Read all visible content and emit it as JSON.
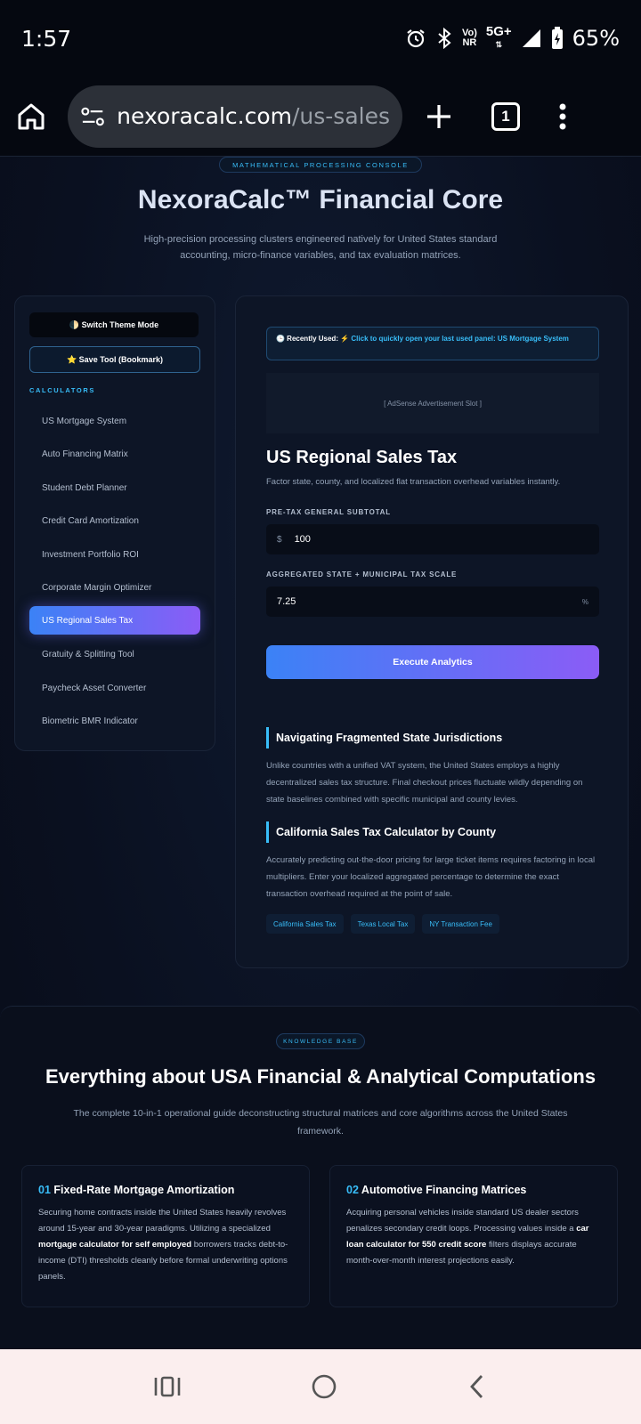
{
  "status": {
    "time": "1:57",
    "net_top": "Vo)",
    "net_bottom": "NR",
    "signal": "5G+",
    "battery": "65%"
  },
  "browser": {
    "url_host": "nexoracalc.com",
    "url_path": "/us-sales",
    "tab_count": "1"
  },
  "hero": {
    "badge": "MATHEMATICAL PROCESSING CONSOLE",
    "title": "NexoraCalc™ Financial Core",
    "subtitle": "High-precision processing clusters engineered natively for United States standard accounting, micro-finance variables, and tax evaluation matrices."
  },
  "sidebar": {
    "theme_button": "🌓 Switch Theme Mode",
    "save_button": "⭐ Save Tool (Bookmark)",
    "heading": "CALCULATORS",
    "items": [
      {
        "label": "US Mortgage System"
      },
      {
        "label": "Auto Financing Matrix"
      },
      {
        "label": "Student Debt Planner"
      },
      {
        "label": "Credit Card Amortization"
      },
      {
        "label": "Investment Portfolio ROI"
      },
      {
        "label": "Corporate Margin Optimizer"
      },
      {
        "label": "US Regional Sales Tax"
      },
      {
        "label": "Gratuity & Splitting Tool"
      },
      {
        "label": "Paycheck Asset Converter"
      },
      {
        "label": "Biometric BMR Indicator"
      }
    ],
    "active_index": 6
  },
  "tool": {
    "recent_label": "🕒 Recently Used:",
    "recent_link": "⚡ Click to quickly open your last used panel: US Mortgage System",
    "ad_slot": "[ AdSense Advertisement Slot ]",
    "title": "US Regional Sales Tax",
    "subtitle": "Factor state, county, and localized flat transaction overhead variables instantly.",
    "subtotal_label": "PRE-TAX GENERAL SUBTOTAL",
    "subtotal_prefix": "$",
    "subtotal_value": "100",
    "rate_label": "AGGREGATED STATE + MUNICIPAL TAX SCALE",
    "rate_value": "7.25",
    "rate_suffix": "%",
    "execute_button": "Execute Analytics",
    "section1_title": "Navigating Fragmented State Jurisdictions",
    "section1_text": "Unlike countries with a unified VAT system, the United States employs a highly decentralized sales tax structure. Final checkout prices fluctuate wildly depending on state baselines combined with specific municipal and county levies.",
    "section2_title": "California Sales Tax Calculator by County",
    "section2_text": "Accurately predicting out-the-door pricing for large ticket items requires factoring in local multipliers. Enter your localized aggregated percentage to determine the exact transaction overhead required at the point of sale.",
    "tags": [
      "California Sales Tax",
      "Texas Local Tax",
      "NY Transaction Fee"
    ]
  },
  "knowledge": {
    "badge": "KNOWLEDGE BASE",
    "title": "Everything about USA Financial & Analytical Computations",
    "subtitle": "The complete 10-in-1 operational guide deconstructing structural matrices and core algorithms across the United States framework.",
    "cards": [
      {
        "num": "01",
        "title": "Fixed-Rate Mortgage Amortization",
        "text_a": "Securing home contracts inside the United States heavily revolves around 15-year and 30-year paradigms. Utilizing a specialized ",
        "bold": "mortgage calculator for self employed",
        "text_b": " borrowers tracks debt-to-income (DTI) thresholds cleanly before formal underwriting options panels."
      },
      {
        "num": "02",
        "title": "Automotive Financing Matrices",
        "text_a": "Acquiring personal vehicles inside standard US dealer sectors penalizes secondary credit loops. Processing values inside a ",
        "bold": "car loan calculator for 550 credit score",
        "text_b": " filters displays accurate month-over-month interest projections easily."
      }
    ]
  },
  "colors": {
    "accent": "#38bdf8",
    "gradient_start": "#3b82f6",
    "gradient_end": "#8b5cf6",
    "background": "#0b1220"
  }
}
